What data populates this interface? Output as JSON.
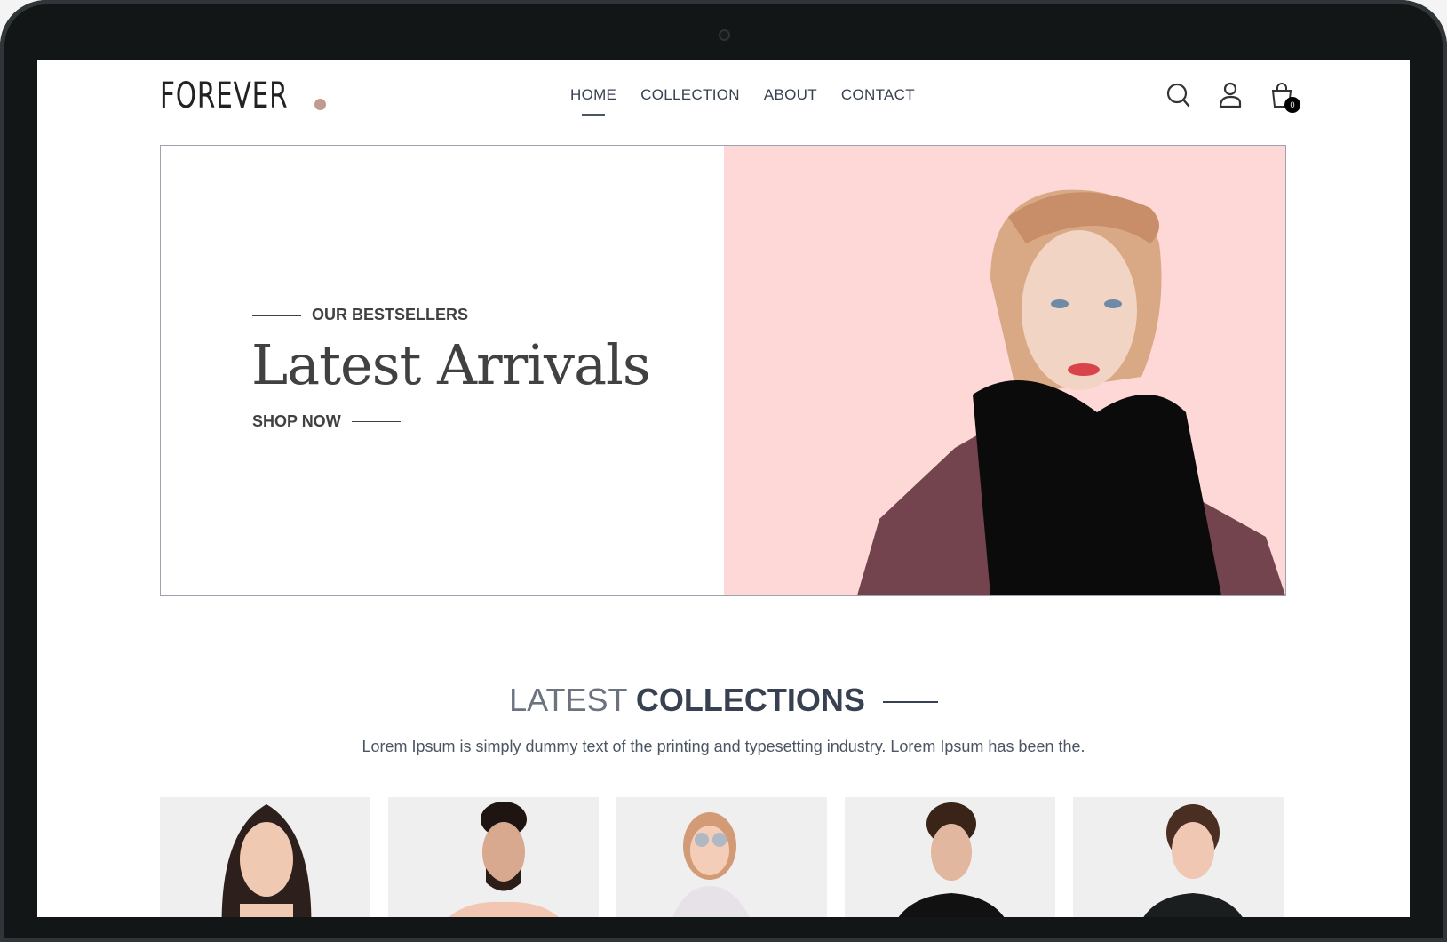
{
  "nav": {
    "logo": "FOREVER",
    "links": [
      {
        "label": "HOME",
        "active": true
      },
      {
        "label": "COLLECTION",
        "active": false
      },
      {
        "label": "ABOUT",
        "active": false
      },
      {
        "label": "CONTACT",
        "active": false
      }
    ],
    "icons": [
      "search-icon",
      "profile-icon",
      "cart-icon"
    ],
    "cart_count": "0"
  },
  "hero": {
    "eyebrow": "OUR BESTSELLERS",
    "title": "Latest Arrivals",
    "cta": "SHOP NOW",
    "bg_color": "#fdd8d6"
  },
  "collections": {
    "title_light": "LATEST",
    "title_bold": "COLLECTIONS",
    "subtitle": "Lorem Ipsum is simply dummy text of the printing and typesetting industry. Lorem Ipsum has been the.",
    "products": [
      {
        "image": "woman-dark-hair"
      },
      {
        "image": "man-beard-pink-shirt"
      },
      {
        "image": "girl-sunglasses-floral"
      },
      {
        "image": "man-curly-black-tee"
      },
      {
        "image": "woman-black-puma-tee"
      }
    ]
  }
}
